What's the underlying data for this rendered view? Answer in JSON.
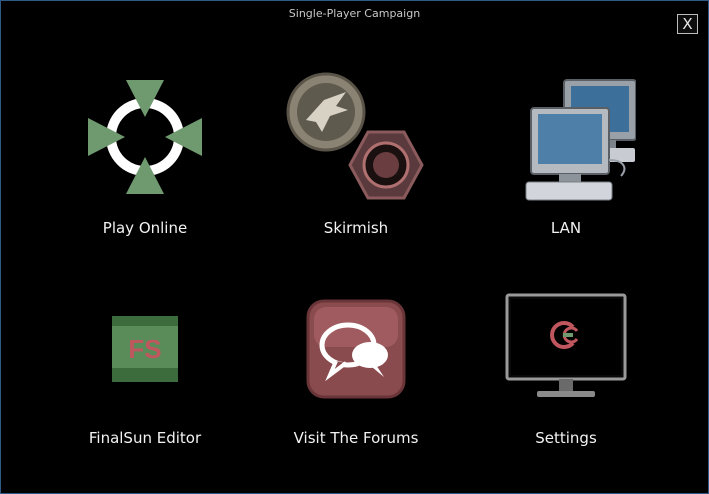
{
  "window": {
    "title": "Single-Player Campaign",
    "close_label": "X"
  },
  "tiles": [
    {
      "id": "play-online",
      "label": "Play Online",
      "icon": "crosshair-arrows-icon"
    },
    {
      "id": "skirmish",
      "label": "Skirmish",
      "icon": "faction-emblems-icon"
    },
    {
      "id": "lan",
      "label": "LAN",
      "icon": "networked-computers-icon"
    },
    {
      "id": "finalsun",
      "label": "FinalSun Editor",
      "icon": "fs-logo-icon",
      "icon_text": "FS"
    },
    {
      "id": "forums",
      "label": "Visit The Forums",
      "icon": "chat-bubbles-icon"
    },
    {
      "id": "settings",
      "label": "Settings",
      "icon": "monitor-settings-icon"
    }
  ],
  "colors": {
    "background": "#000000",
    "accent_green": "#6f9a6f",
    "forum_red": "#8a4b4e",
    "fs_green": "#3c6b3c",
    "fs_text": "#c0565e"
  }
}
